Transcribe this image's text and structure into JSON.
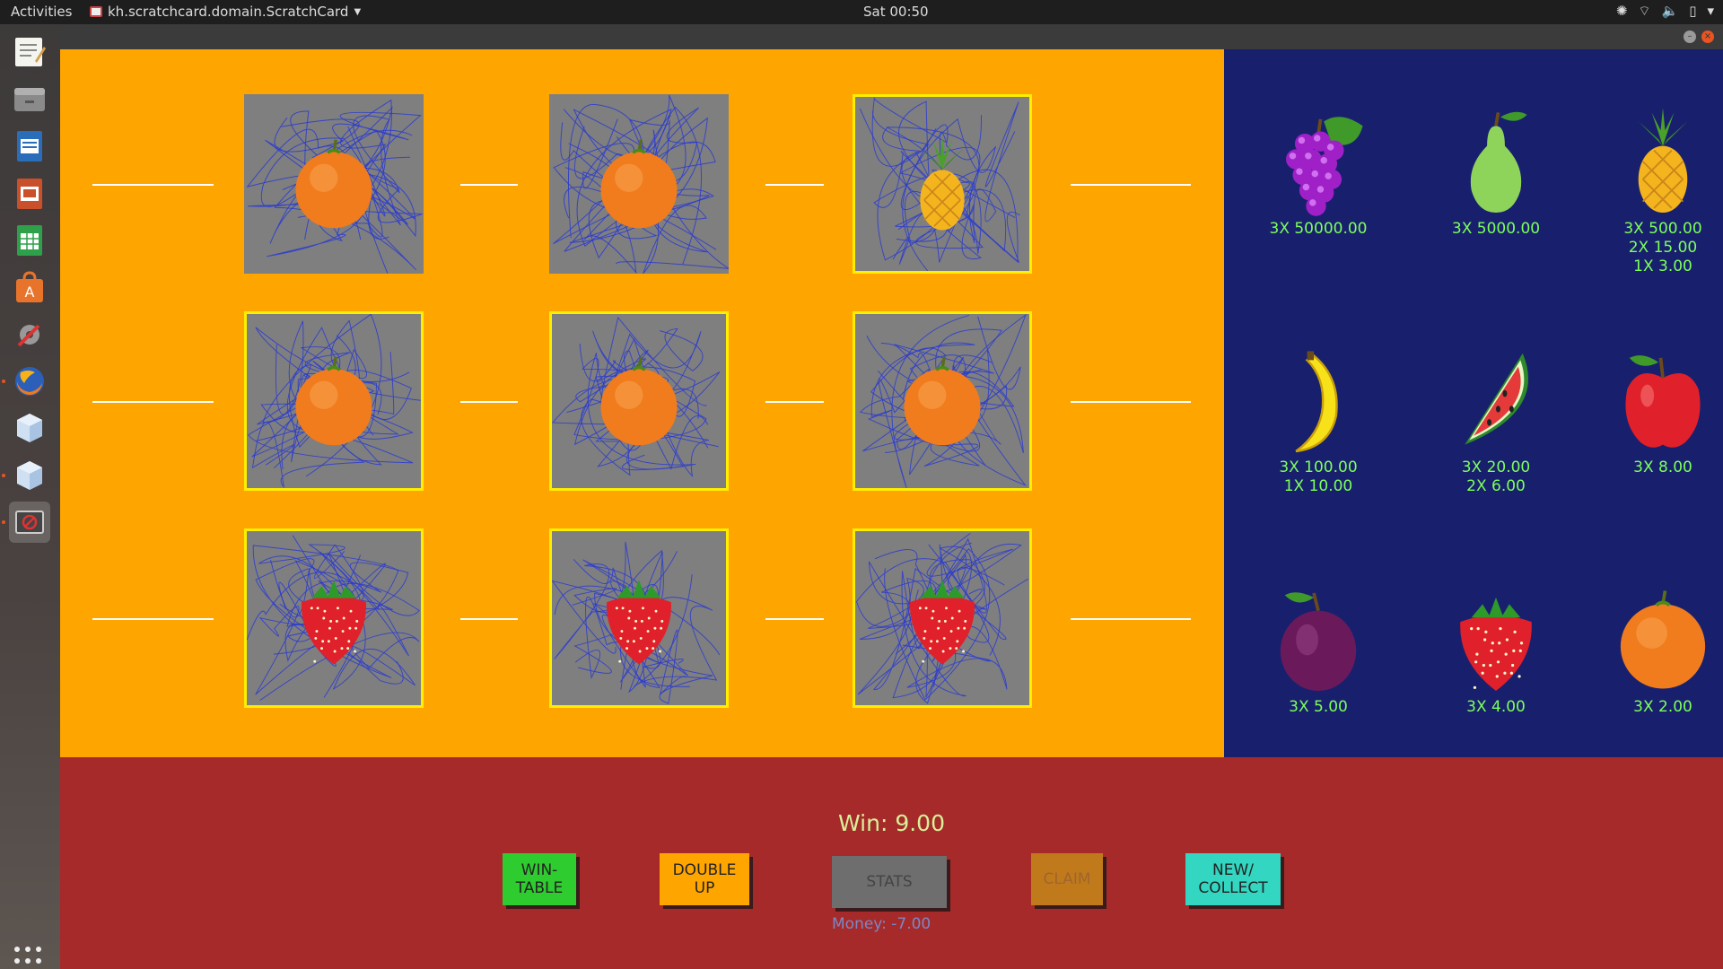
{
  "topbar": {
    "activities": "Activities",
    "app_name": "kh.scratchcard.domain.ScratchCard",
    "clock": "Sat 00:50"
  },
  "dock": {
    "items": [
      "text-editor-icon",
      "file-manager-icon",
      "writer-icon",
      "impress-icon",
      "calc-icon",
      "software-center-icon",
      "settings-icon",
      "firefox-icon",
      "cube-app-icon",
      "cube-app-icon-2",
      "scratchcard-app-icon"
    ]
  },
  "board": {
    "rows": [
      [
        "orange",
        "orange",
        "pineapple"
      ],
      [
        "orange",
        "orange",
        "orange"
      ],
      [
        "strawberry",
        "strawberry",
        "strawberry"
      ]
    ]
  },
  "paytable": [
    {
      "fruit": "grape",
      "lines": [
        "3X 50000.00"
      ]
    },
    {
      "fruit": "pear",
      "lines": [
        "3X 5000.00"
      ]
    },
    {
      "fruit": "pineapple",
      "lines": [
        "3X 500.00",
        "2X 15.00",
        "1X 3.00"
      ]
    },
    {
      "fruit": "banana",
      "lines": [
        "3X 100.00",
        "1X 10.00"
      ]
    },
    {
      "fruit": "watermelon",
      "lines": [
        "3X 20.00",
        "2X 6.00"
      ]
    },
    {
      "fruit": "apple",
      "lines": [
        "3X 8.00"
      ]
    },
    {
      "fruit": "plum",
      "lines": [
        "3X 5.00"
      ]
    },
    {
      "fruit": "strawberry",
      "lines": [
        "3X 4.00"
      ]
    },
    {
      "fruit": "orange",
      "lines": [
        "3X 2.00"
      ]
    }
  ],
  "status": {
    "win": "Win: 9.00",
    "money": "Money: -7.00"
  },
  "buttons": {
    "wintable_l1": "WIN-",
    "wintable_l2": "TABLE",
    "double_l1": "DOUBLE",
    "double_l2": "UP",
    "stats": "STATS",
    "claim": "CLAIM",
    "new_l1": "NEW/",
    "new_l2": "COLLECT"
  },
  "colors": {
    "board_bg": "#ffa500",
    "paytable_bg": "#18206e",
    "bottom_bg": "#a62a2a",
    "win_frame": "#ffee00",
    "pay_text": "#7dff5a"
  }
}
